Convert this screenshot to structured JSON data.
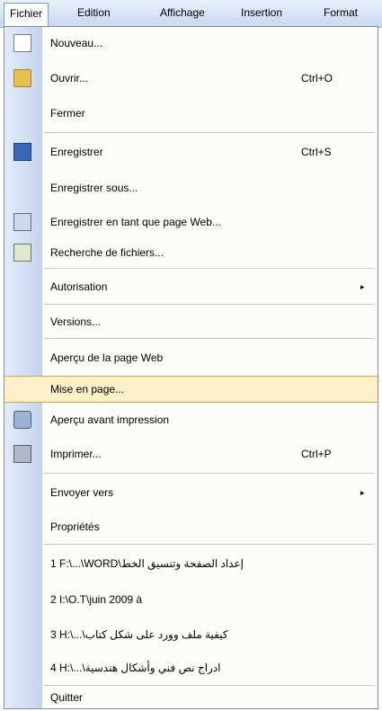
{
  "menubar": {
    "items": [
      "Fichier",
      "Edition",
      "Affichage",
      "Insertion",
      "Format"
    ]
  },
  "menu": {
    "items": [
      {
        "label": "Nouveau...",
        "shortcut": "",
        "icon": "new-document-icon"
      },
      {
        "label": "Ouvrir...",
        "shortcut": "Ctrl+O",
        "icon": "open-folder-icon"
      },
      {
        "label": "Fermer",
        "shortcut": "",
        "icon": ""
      },
      {
        "label": "Enregistrer",
        "shortcut": "Ctrl+S",
        "icon": "save-disk-icon"
      },
      {
        "label": "Enregistrer sous...",
        "shortcut": "",
        "icon": ""
      },
      {
        "label": "Enregistrer en tant que page Web...",
        "shortcut": "",
        "icon": "web-page-icon"
      },
      {
        "label": "Recherche de fichiers...",
        "shortcut": "",
        "icon": "file-search-icon"
      },
      {
        "label": "Autorisation",
        "shortcut": "",
        "icon": "",
        "submenu": true
      },
      {
        "label": "Versions...",
        "shortcut": "",
        "icon": ""
      },
      {
        "label": "Aperçu de la page Web",
        "shortcut": "",
        "icon": ""
      },
      {
        "label": "Mise en page...",
        "shortcut": "",
        "icon": "",
        "highlighted": true
      },
      {
        "label": "Aperçu avant impression",
        "shortcut": "",
        "icon": "print-preview-icon"
      },
      {
        "label": "Imprimer...",
        "shortcut": "Ctrl+P",
        "icon": "printer-icon"
      },
      {
        "label": "Envoyer vers",
        "shortcut": "",
        "icon": "",
        "submenu": true
      },
      {
        "label": "Propriétés",
        "shortcut": "",
        "icon": ""
      },
      {
        "label": "1 F:\\...\\WORD\\إعداد الصفحة وتنسيق الخط",
        "shortcut": "",
        "icon": ""
      },
      {
        "label": "2 I:\\O.T\\juin 2009 à",
        "shortcut": "",
        "icon": ""
      },
      {
        "label": "3 H:\\...\\كيفية ملف وورد على شكل كتاب",
        "shortcut": "",
        "icon": ""
      },
      {
        "label": "4 H:\\...\\ادراج نص فني وأشكال هندسية",
        "shortcut": "",
        "icon": ""
      },
      {
        "label": "Quitter",
        "shortcut": "",
        "icon": ""
      }
    ],
    "submenu_arrow": "▸"
  },
  "colors": {
    "menubar_bg": "#c8d8f2",
    "gutter": "#c4d4ef",
    "highlight": "#fff0c9",
    "highlight_border": "#e0a43a"
  }
}
